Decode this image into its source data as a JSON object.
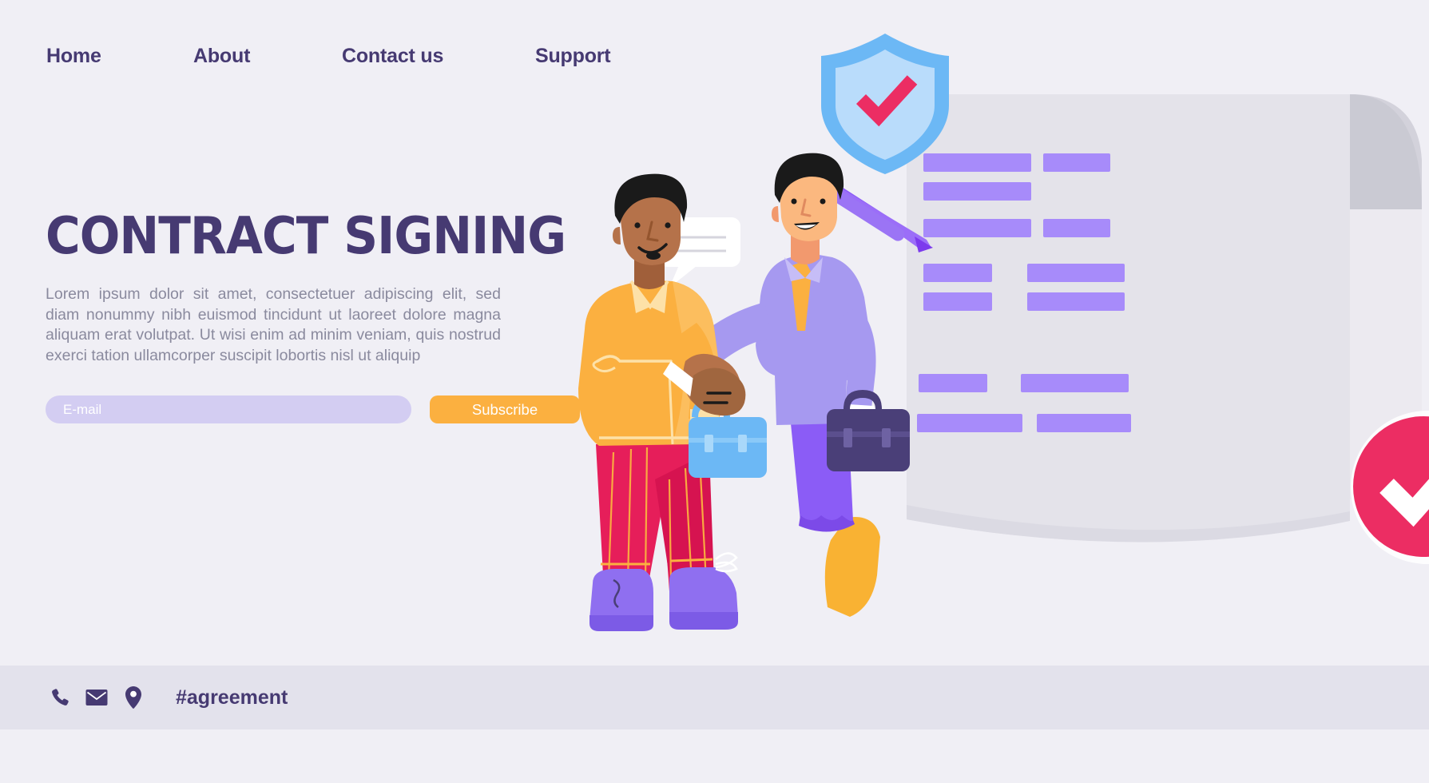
{
  "nav": {
    "items": [
      {
        "label": "Home",
        "name": "nav-home"
      },
      {
        "label": "About",
        "name": "nav-about"
      },
      {
        "label": "Contact us",
        "name": "nav-contact-us"
      },
      {
        "label": "Support",
        "name": "nav-support"
      }
    ]
  },
  "hero": {
    "title": "CONTRACT SIGNING",
    "paragraph": "Lorem ipsum dolor sit amet, consectetuer adipiscing elit, sed diam nonummy nibh euismod tincidunt ut laoreet dolore magna aliquam erat volutpat. Ut wisi enim ad minim veniam, quis nostrud exerci tation ullamcorper suscipit lobortis nisl ut aliquip"
  },
  "form": {
    "email_placeholder": "E-mail",
    "email_value": "",
    "subscribe_label": "Subscribe"
  },
  "footer": {
    "hashtag": "#agreement",
    "icons": [
      "phone-icon",
      "envelope-icon",
      "map-pin-icon"
    ]
  },
  "illustration": {
    "title": "contract-signing-illustration",
    "elements": [
      "shield-badge-icon",
      "pen-icon",
      "contract-document",
      "check-circle-badge",
      "speech-bubble",
      "person-left-handshake",
      "person-right-handshake",
      "briefcase-blue",
      "briefcase-navy"
    ]
  },
  "colors": {
    "background": "#f0eff5",
    "footer_band": "#e3e2ec",
    "heading": "#463a72",
    "body_text": "#8a8a9e",
    "accent_orange": "#fbb040",
    "input_fill": "#d3cdf2",
    "doc_bar_purple": "#a78bfa",
    "doc_paper": "#e4e3ea",
    "doc_curl": "#cdccd6",
    "shield_blue": "#6cb8f5",
    "shield_inner": "#b9dcfb",
    "check_pink": "#ec2d63",
    "pants_pink": "#e61e5a",
    "sweater_yellow": "#fbb040",
    "shirt_lavender": "#a699f0",
    "pants_purple": "#8b5cf6",
    "shoe_purple": "#8f6ff0",
    "shoe_orange": "#fbb040",
    "briefcase_blue": "#6cb8f5",
    "briefcase_navy": "#4a3f78",
    "skin_left": "#b5724a",
    "skin_right": "#f2996e",
    "hair": "#1a1a1a"
  }
}
